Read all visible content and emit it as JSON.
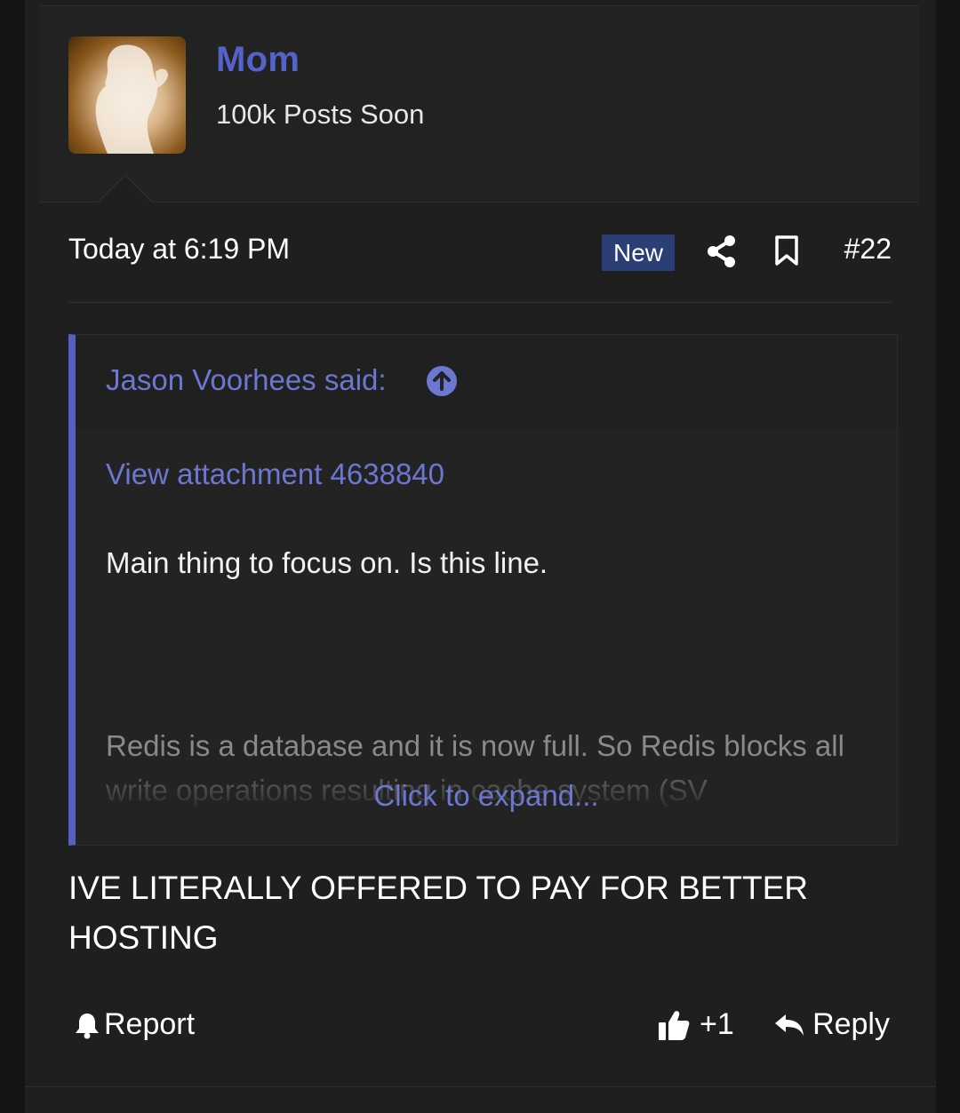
{
  "user": {
    "name": "Mom",
    "title": "100k Posts Soon"
  },
  "post": {
    "date": "Today at 6:19 PM",
    "badge": "New",
    "number": "#22",
    "body": "IVE LITERALLY OFFERED TO PAY FOR BETTER HOSTING"
  },
  "quote": {
    "author": "Jason Voorhees said:",
    "attachment_link": "View attachment 4638840",
    "line1": "Main thing to focus on. Is this line.",
    "faded_text": "Redis is a database and it is now full. So Redis blocks all write operations resulting in cache system (SV",
    "expand_label": "Click to expand..."
  },
  "footer": {
    "report_label": "Report",
    "like_label": "+1",
    "reply_label": "Reply"
  },
  "icons": {
    "share": "share-icon",
    "bookmark": "bookmark-icon",
    "go_to_quote": "arrow-up-circle-icon",
    "report": "bell-icon",
    "like": "thumbs-up-icon",
    "reply": "reply-arrow-icon"
  },
  "colors": {
    "accent": "#5563c9",
    "link": "#6b77d0",
    "badge": "#2b3e75",
    "background": "#1f1f1f"
  }
}
